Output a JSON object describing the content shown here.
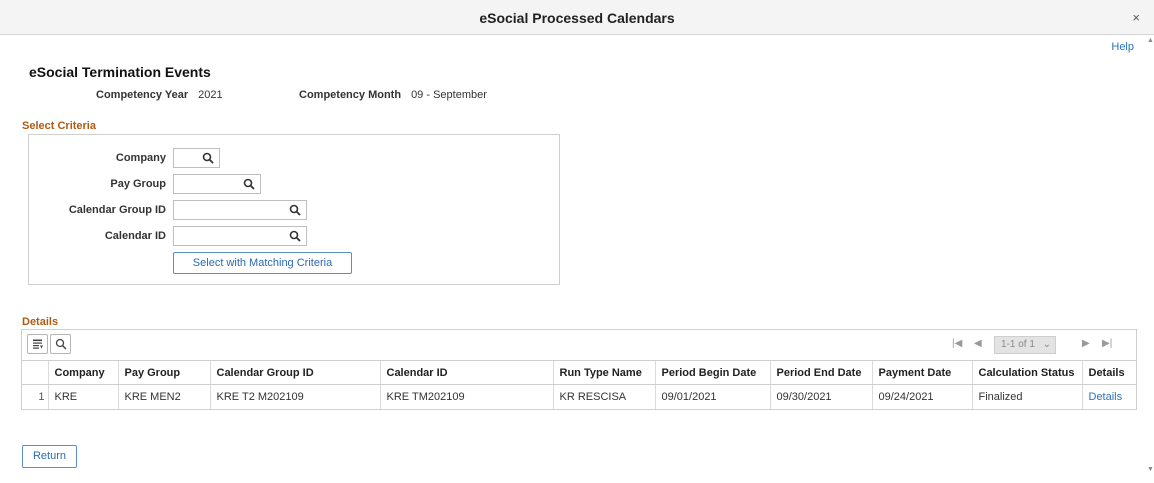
{
  "window": {
    "title": "eSocial Processed Calendars",
    "close_glyph": "×"
  },
  "help_label": "Help",
  "heading": "eSocial Termination Events",
  "competency": {
    "year_label": "Competency Year",
    "year_value": "2021",
    "month_label": "Competency Month",
    "month_value": "09 - September"
  },
  "criteria": {
    "section_title": "Select Criteria",
    "fields": [
      {
        "label": "Company",
        "value": ""
      },
      {
        "label": "Pay Group",
        "value": ""
      },
      {
        "label": "Calendar Group ID",
        "value": ""
      },
      {
        "label": "Calendar ID",
        "value": ""
      }
    ],
    "button_label": "Select with Matching Criteria"
  },
  "details": {
    "section_title": "Details",
    "pager": {
      "count": "1-1 of 1",
      "first": "|◀",
      "prev": "◀",
      "next": "▶",
      "last": "▶|",
      "dropdown": "⌄"
    },
    "columns": [
      "Company",
      "Pay Group",
      "Calendar Group ID",
      "Calendar ID",
      "Run Type Name",
      "Period Begin Date",
      "Period End Date",
      "Payment Date",
      "Calculation Status",
      "Details"
    ],
    "rows": [
      {
        "num": "1",
        "cells": [
          "KRE",
          "KRE MEN2",
          "KRE T2 M202109",
          "KRE TM202109",
          "KR RESCISA",
          "09/01/2021",
          "09/30/2021",
          "09/24/2021",
          "Finalized",
          "Details"
        ]
      }
    ]
  },
  "return_label": "Return",
  "colors": {
    "accent_blue": "#2a74b9",
    "section_orange": "#b05a12"
  },
  "icons": {
    "close": "close-icon",
    "search": "search-icon",
    "grid_settings": "grid-personalize-icon"
  }
}
